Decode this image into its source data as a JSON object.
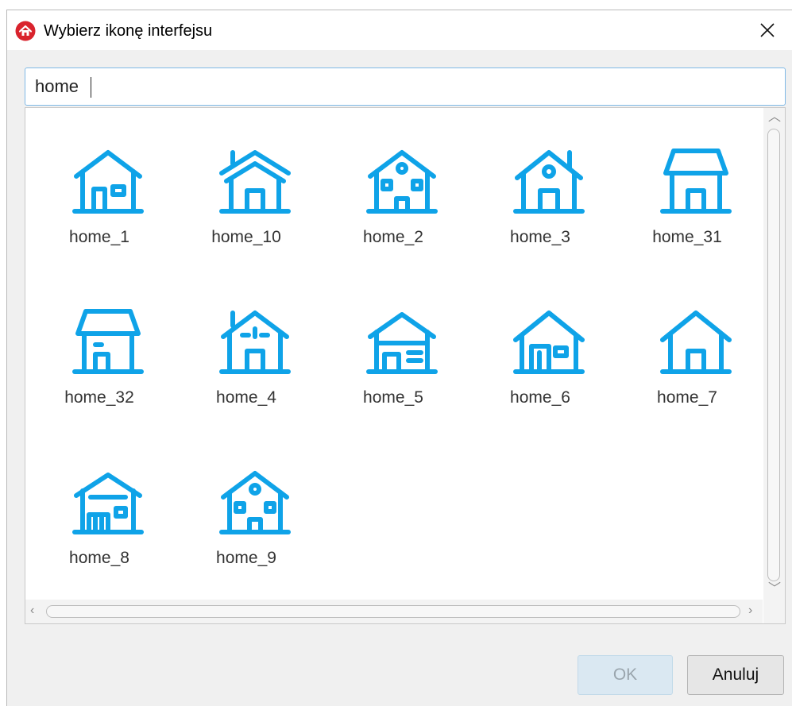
{
  "window": {
    "title": "Wybierz ikonę interfejsu",
    "close_label": "✕"
  },
  "search": {
    "value": "home"
  },
  "icons": [
    {
      "label": "home_1"
    },
    {
      "label": "home_10"
    },
    {
      "label": "home_2"
    },
    {
      "label": "home_3"
    },
    {
      "label": "home_31"
    },
    {
      "label": "home_32"
    },
    {
      "label": "home_4"
    },
    {
      "label": "home_5"
    },
    {
      "label": "home_6"
    },
    {
      "label": "home_7"
    },
    {
      "label": "home_8"
    },
    {
      "label": "home_9"
    }
  ],
  "buttons": {
    "ok": "OK",
    "cancel": "Anuluj"
  },
  "colors": {
    "icon_blue": "#0fa3e8",
    "app_icon_red": "#d9232d"
  }
}
